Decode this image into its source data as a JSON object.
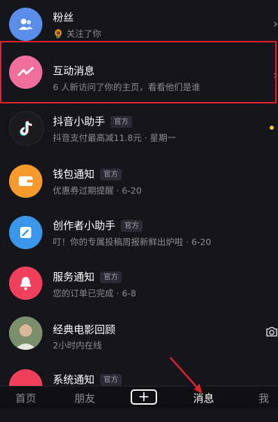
{
  "messages": [
    {
      "title": "粉丝",
      "sub_icon": "sunflower-icon",
      "sub": "关注了你",
      "tag": "",
      "time": "",
      "avatar_color": "#5a8ee8",
      "icon": "users-icon"
    },
    {
      "title": "互动消息",
      "sub": "6 人新访问了你的主页，看看他们是谁",
      "tag": "",
      "time": "",
      "avatar_color": "#f06e9c",
      "icon": "chat-wave-icon"
    },
    {
      "title": "抖音小助手",
      "sub": "抖音支付最高减11.8元 · 星期一",
      "tag": "官方",
      "time": "",
      "avatar_color": "#1a1a1f",
      "icon": "tiktok-icon"
    },
    {
      "title": "钱包通知",
      "sub": "优惠券过期提醒 · 6-20",
      "tag": "官方",
      "time": "",
      "avatar_color": "#f59a2b",
      "icon": "wallet-icon"
    },
    {
      "title": "创作者小助手",
      "sub": "叮！你的专属投稿周报新鲜出炉啦 · 6-20",
      "tag": "官方",
      "time": "",
      "avatar_color": "#3a96e8",
      "icon": "edit-icon"
    },
    {
      "title": "服务通知",
      "sub": "您的订单已完成 · 6-8",
      "tag": "官方",
      "time": "",
      "avatar_color": "#f0405c",
      "icon": "bell-icon"
    },
    {
      "title": "经典电影回顾",
      "sub": "2小时内在线",
      "tag": "",
      "time": "",
      "avatar_color": "#6c7b5e",
      "icon": "person-photo-icon"
    },
    {
      "title": "系统通知",
      "sub": "",
      "tag": "官方",
      "time": "",
      "avatar_color": "#f0405c",
      "icon": "system-icon"
    }
  ],
  "tabs": {
    "home": "首页",
    "friends": "朋友",
    "add": "+",
    "messages": "消息",
    "me": "我"
  },
  "colors": {
    "highlight": "#e5212b",
    "unread_dot": "#f5c22b"
  }
}
